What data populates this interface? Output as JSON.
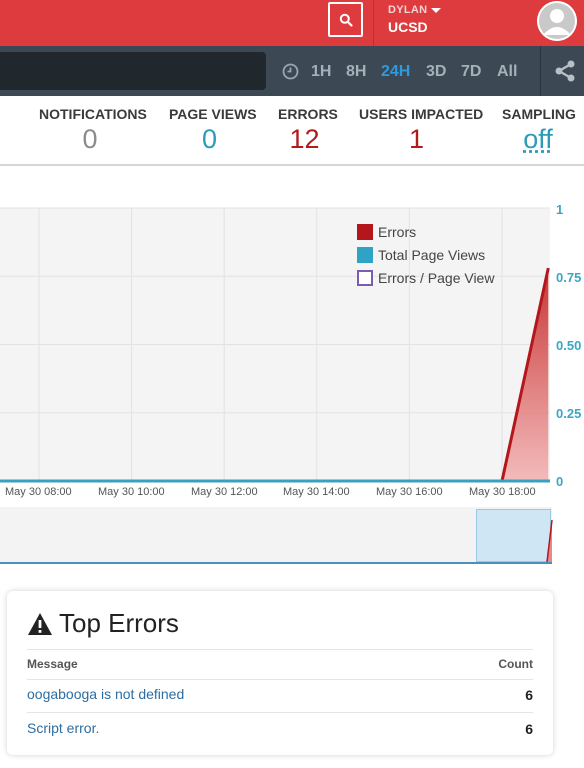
{
  "header": {
    "user_name": "DYLAN",
    "org_name": "UCSD",
    "search_icon": "search-icon",
    "avatar_icon": "user-avatar-icon"
  },
  "toolbar": {
    "search_placeholder": "",
    "time_ranges": [
      "1H",
      "8H",
      "24H",
      "3D",
      "7D",
      "All"
    ],
    "active_range": "24H",
    "icons": [
      "clock-icon",
      "share-icon"
    ]
  },
  "stats": [
    {
      "label": "NOTIFICATIONS",
      "value": "0",
      "color": "#8c8c8c"
    },
    {
      "label": "PAGE VIEWS",
      "value": "0",
      "color": "#2c9bb8"
    },
    {
      "label": "ERRORS",
      "value": "12",
      "color": "#b31b1b"
    },
    {
      "label": "USERS IMPACTED",
      "value": "1",
      "color": "#b31b1b"
    },
    {
      "label": "SAMPLING",
      "value": "off",
      "color": "#2c9bb8"
    }
  ],
  "chart_data": {
    "type": "area",
    "legend": [
      "Errors",
      "Total Page Views",
      "Errors / Page View"
    ],
    "legend_colors": [
      "#b3171c",
      "#2ea3c4",
      "#7a5cb5"
    ],
    "legend_placement": "top-right",
    "x_ticks": [
      "May 30 08:00",
      "May 30 10:00",
      "May 30 12:00",
      "May 30 14:00",
      "May 30 16:00",
      "May 30 18:00"
    ],
    "y_ticks": [
      "0",
      "0.25",
      "0.50",
      "0.75",
      "1"
    ],
    "ylim": [
      0,
      1
    ],
    "grid": true,
    "series": [
      {
        "name": "Errors",
        "x": [
          "May 30 18:00",
          "May 30 19:00"
        ],
        "values": [
          0,
          0.78
        ]
      },
      {
        "name": "Total Page Views",
        "x": [
          "May 30 18:00",
          "May 30 19:00"
        ],
        "values": [
          0,
          0
        ]
      }
    ]
  },
  "top_errors": {
    "title": "Top Errors",
    "col_message": "Message",
    "col_count": "Count",
    "rows": [
      {
        "message": "oogabooga is not defined",
        "count": "6"
      },
      {
        "message": "Script error.",
        "count": "6"
      }
    ]
  }
}
